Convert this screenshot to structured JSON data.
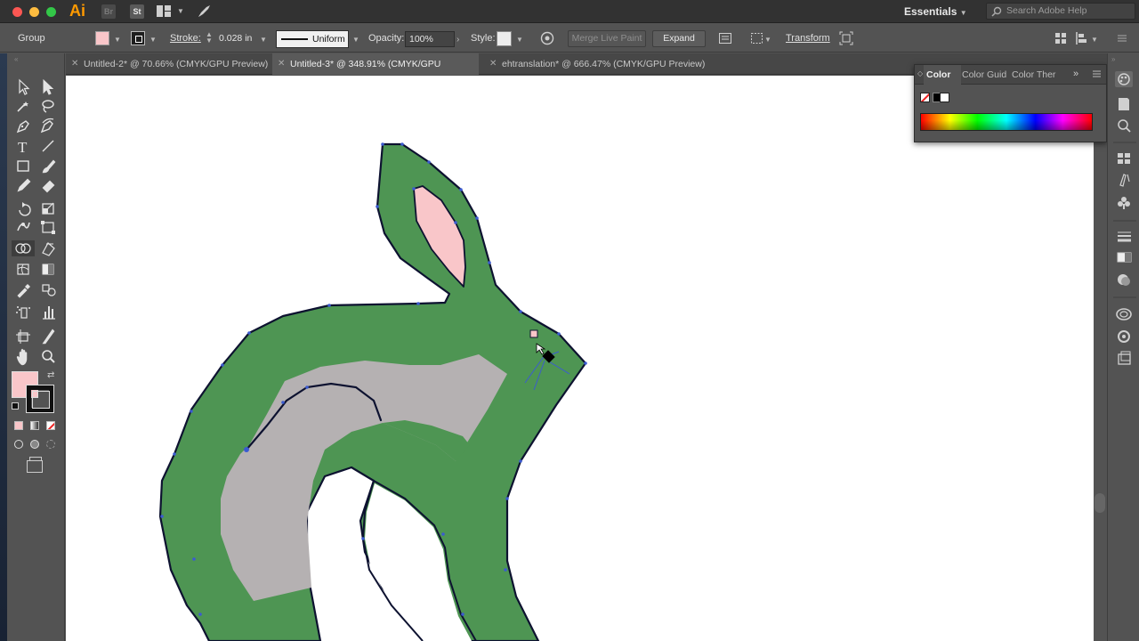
{
  "app": {
    "logo": "Ai",
    "bridge_label": "Br",
    "stock_label": "St",
    "workspace": "Essentials",
    "help_placeholder": "Search Adobe Help"
  },
  "control_bar": {
    "selection_type": "Group",
    "fill_color": "#f9c6c9",
    "stroke_label": "Stroke:",
    "stroke_weight": "0.028 in",
    "stroke_profile": "Uniform",
    "opacity_label": "Opacity:",
    "opacity_value": "100%",
    "style_label": "Style:",
    "merge_live_paint": "Merge Live Paint",
    "expand": "Expand",
    "transform": "Transform"
  },
  "tabs": [
    {
      "label": "Untitled-2* @ 70.66% (CMYK/GPU Preview)",
      "active": false
    },
    {
      "label": "Untitled-3* @ 348.91% (CMYK/GPU Preview)",
      "active": true
    },
    {
      "label": "ehtranslation* @ 666.47% (CMYK/GPU Preview)",
      "active": false
    }
  ],
  "color_panel": {
    "tabs": [
      "Color",
      "Color Guid",
      "Color Ther"
    ],
    "active_tab": "Color"
  },
  "colors": {
    "rabbit_green": "#4e9553",
    "rabbit_gray": "#b5b1b2",
    "ear_pink": "#f9c6c9",
    "outline": "#0d1230",
    "anchor_blue": "#3b5bd1"
  },
  "tools": [
    "selection-tool",
    "direct-selection-tool",
    "magic-wand-tool",
    "lasso-tool",
    "pen-tool",
    "curvature-tool",
    "type-tool",
    "line-segment-tool",
    "rectangle-tool",
    "paintbrush-tool",
    "pencil-tool",
    "eraser-tool",
    "rotate-tool",
    "scale-tool",
    "warp-tool",
    "free-transform-tool",
    "shape-builder-tool",
    "live-paint-bucket-tool",
    "mesh-tool",
    "gradient-tool",
    "eyedropper-tool",
    "blend-tool",
    "symbol-sprayer-tool",
    "column-graph-tool",
    "artboard-tool",
    "slice-tool",
    "hand-tool",
    "zoom-tool"
  ]
}
